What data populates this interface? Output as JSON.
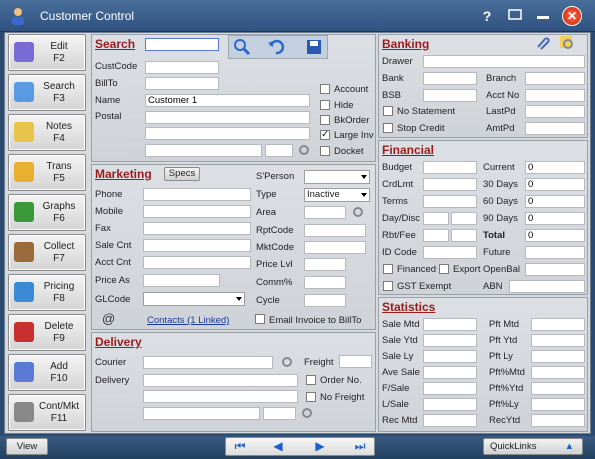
{
  "window": {
    "title": "Customer Control"
  },
  "sidebar": {
    "items": [
      {
        "label": "Edit",
        "key": "F2",
        "icon": "edit-icon",
        "color": "#6a5acd"
      },
      {
        "label": "Search",
        "key": "F3",
        "icon": "search-icon",
        "color": "#3a7bd5"
      },
      {
        "label": "Notes",
        "key": "F4",
        "icon": "notes-icon",
        "color": "#e8c44a"
      },
      {
        "label": "Trans",
        "key": "F5",
        "icon": "folder-icon",
        "color": "#e8b030"
      },
      {
        "label": "Graphs",
        "key": "F6",
        "icon": "graph-icon",
        "color": "#3a9a3a"
      },
      {
        "label": "Collect",
        "key": "F7",
        "icon": "collect-icon",
        "color": "#9a6a3a"
      },
      {
        "label": "Pricing",
        "key": "F8",
        "icon": "calculator-icon",
        "color": "#3a8ad5"
      },
      {
        "label": "Delete",
        "key": "F9",
        "icon": "delete-icon",
        "color": "#c83030"
      },
      {
        "label": "Add",
        "key": "F10",
        "icon": "add-icon",
        "color": "#5a7ad5"
      },
      {
        "label": "Cont/Mkt",
        "key": "F11",
        "icon": "contact-icon",
        "color": "#888888"
      }
    ]
  },
  "search": {
    "title": "Search",
    "custcode_label": "CustCode",
    "billto_label": "BillTo",
    "name_label": "Name",
    "name_value": "Customer 1",
    "postal_label": "Postal",
    "checks": [
      "Account",
      "Hide",
      "BkOrder",
      "Large Inv",
      "Docket"
    ]
  },
  "marketing": {
    "title": "Marketing",
    "specs_label": "Specs",
    "phone": "Phone",
    "mobile": "Mobile",
    "fax": "Fax",
    "salecnt": "Sale Cnt",
    "acctcnt": "Acct Cnt",
    "priceas": "Price As",
    "glcode": "GLCode",
    "contacts_link": "Contacts (1 Linked)",
    "sperson": "S'Person",
    "type": "Type",
    "type_value": "Inactive",
    "area": "Area",
    "rptcode": "RptCode",
    "mktcode": "MktCode",
    "pricelvl": "Price Lvl",
    "comm": "Comm%",
    "cycle": "Cycle",
    "email_invoice": "Email Invoice to BillTo"
  },
  "delivery": {
    "title": "Delivery",
    "courier": "Courier",
    "delivery": "Delivery",
    "freight": "Freight",
    "order_no": "Order No.",
    "no_freight": "No Freight"
  },
  "banking": {
    "title": "Banking",
    "drawer": "Drawer",
    "bank": "Bank",
    "bsb": "BSB",
    "branch": "Branch",
    "acctno": "Acct No",
    "lastpd": "LastPd",
    "amtpd": "AmtPd",
    "no_statement": "No Statement",
    "stop_credit": "Stop Credit"
  },
  "financial": {
    "title": "Financial",
    "budget": "Budget",
    "crdlmt": "CrdLmt",
    "terms": "Terms",
    "daydisc": "Day/Disc",
    "rbtfee": "Rbt/Fee",
    "idcode": "ID Code",
    "financed": "Financed",
    "export": "Export",
    "gst": "GST Exempt",
    "current": "Current",
    "d30": "30 Days",
    "d60": "60 Days",
    "d90": "90 Days",
    "total": "Total",
    "future": "Future",
    "openbal": "OpenBal",
    "abn": "ABN",
    "v_current": "0",
    "v_30": "0",
    "v_60": "0",
    "v_90": "0",
    "v_total": "0"
  },
  "statistics": {
    "title": "Statistics",
    "left": [
      "Sale Mtd",
      "Sale Ytd",
      "Sale Ly",
      "Ave Sale",
      "F/Sale",
      "L/Sale",
      "Rec Mtd"
    ],
    "right": [
      "Pft Mtd",
      "Pft Ytd",
      "Pft Ly",
      "Pft%Mtd",
      "Pft%Ytd",
      "Pft%Ly",
      "RecYtd"
    ]
  },
  "bottom": {
    "view_label": "View",
    "quicklinks_label": "QuickLinks"
  }
}
